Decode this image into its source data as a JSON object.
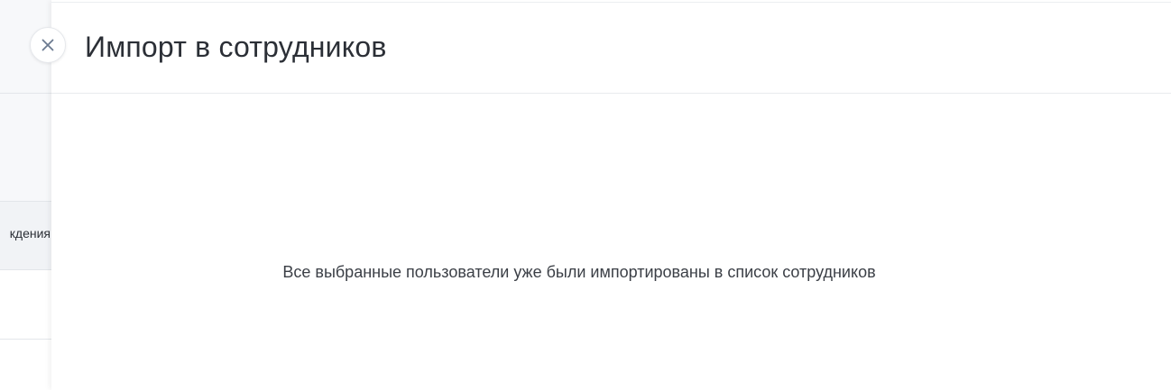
{
  "background_page": {
    "table_header_fragment": "кдения"
  },
  "drawer": {
    "title": "Импорт в сотрудников",
    "empty_message": "Все выбранные пользователи уже были импортированы в список сотрудников",
    "close_icon": "close-icon"
  },
  "colors": {
    "close_icon": "#6b7a90",
    "title_text": "#2b2f36",
    "body_text": "#3b3f46"
  }
}
